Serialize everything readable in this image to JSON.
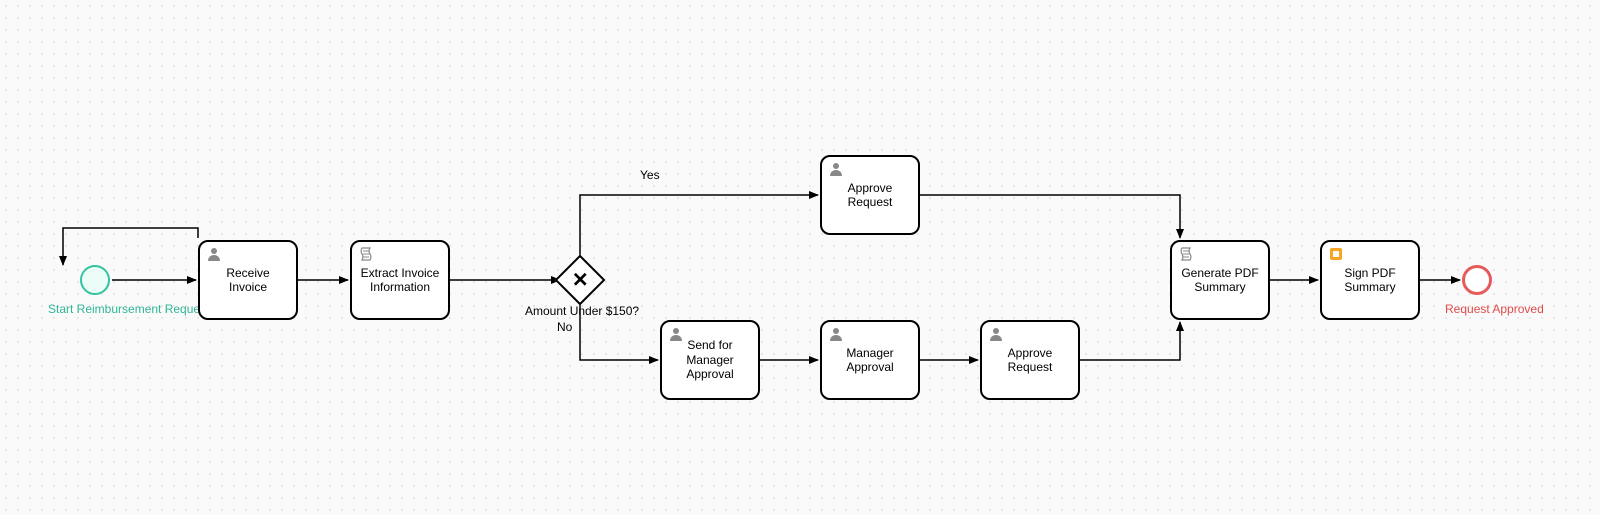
{
  "start": {
    "label": "Start Reimbursement Request"
  },
  "end": {
    "label": "Request Approved"
  },
  "gateway": {
    "label": "Amount Under $150?",
    "yes": "Yes",
    "no": "No"
  },
  "tasks": {
    "receive": {
      "label": "Receive Invoice",
      "marker": "user"
    },
    "extract": {
      "label": "Extract Invoice Information",
      "marker": "script"
    },
    "approveTop": {
      "label": "Approve Request",
      "marker": "user"
    },
    "sendMgr": {
      "label": "Send for Manager Approval",
      "marker": "user"
    },
    "mgrApproval": {
      "label": "Manager Approval",
      "marker": "user"
    },
    "approveBottom": {
      "label": "Approve Request",
      "marker": "user"
    },
    "genPdf": {
      "label": "Generate PDF Summary",
      "marker": "script"
    },
    "signPdf": {
      "label": "Sign PDF Summary",
      "marker": "doc"
    }
  }
}
